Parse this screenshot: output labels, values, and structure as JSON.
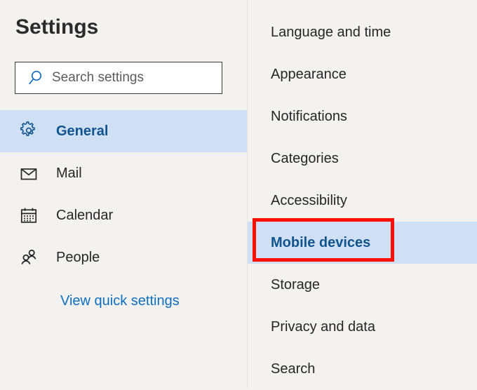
{
  "header": {
    "title": "Settings"
  },
  "search": {
    "placeholder": "Search settings",
    "icon": "search-icon",
    "icon_color": "#106ebe"
  },
  "sidebar": {
    "items": [
      {
        "label": "General",
        "icon": "gear-icon",
        "selected": true
      },
      {
        "label": "Mail",
        "icon": "envelope-icon",
        "selected": false
      },
      {
        "label": "Calendar",
        "icon": "calendar-icon",
        "selected": false
      },
      {
        "label": "People",
        "icon": "people-icon",
        "selected": false
      }
    ],
    "quick_settings_link": "View quick settings"
  },
  "subpanel": {
    "items": [
      {
        "label": "Language and time",
        "selected": false
      },
      {
        "label": "Appearance",
        "selected": false
      },
      {
        "label": "Notifications",
        "selected": false
      },
      {
        "label": "Categories",
        "selected": false
      },
      {
        "label": "Accessibility",
        "selected": false
      },
      {
        "label": "Mobile devices",
        "selected": true
      },
      {
        "label": "Storage",
        "selected": false
      },
      {
        "label": "Privacy and data",
        "selected": false
      },
      {
        "label": "Search",
        "selected": false
      }
    ]
  },
  "annotation": {
    "target_label": "Mobile devices",
    "color": "#fa0f00"
  },
  "colors": {
    "background": "#f3f2f1",
    "selection": "#cfe0f4",
    "accent_blue": "#106ebe",
    "selected_text": "#10548f",
    "text": "#262626",
    "placeholder": "#5c5c5c"
  }
}
